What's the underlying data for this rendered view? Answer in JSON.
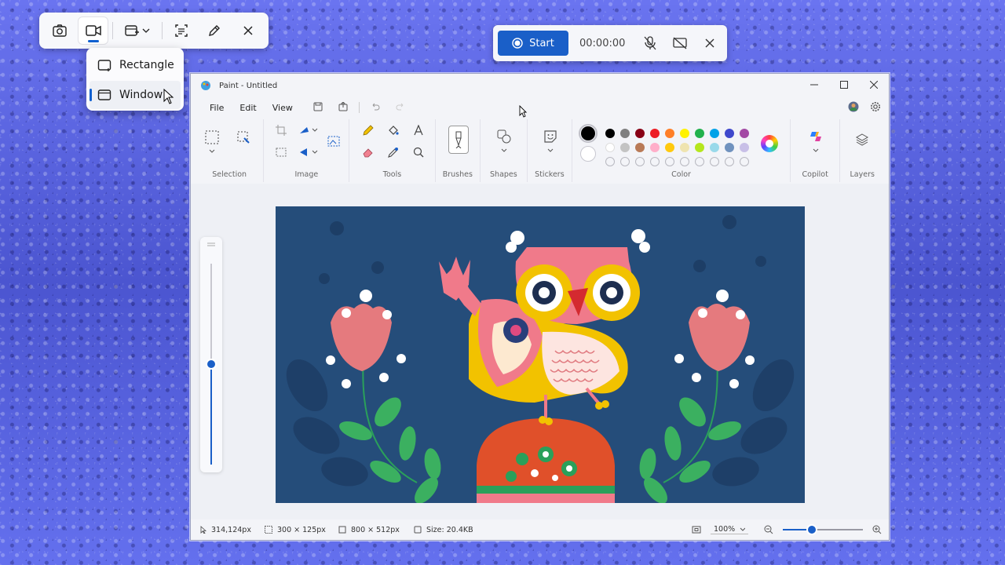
{
  "snip_toolbar": {
    "tools": [
      "camera-icon",
      "video-icon",
      "window-mode-icon",
      "text-actions-icon",
      "pen-icon",
      "close-icon"
    ]
  },
  "mode_menu": {
    "items": [
      {
        "label": "Rectangle",
        "icon": "rectangle-icon",
        "selected": false
      },
      {
        "label": "Window",
        "icon": "window-icon",
        "selected": true
      }
    ]
  },
  "record_bar": {
    "start_label": "Start",
    "timer": "00:00:00",
    "accent": "#1a5fc8"
  },
  "paint": {
    "title": "Paint - Untitled",
    "menu": [
      "File",
      "Edit",
      "View"
    ],
    "ribbon_groups": {
      "selection": "Selection",
      "image": "Image",
      "tools": "Tools",
      "brushes": "Brushes",
      "shapes": "Shapes",
      "stickers": "Stickers",
      "color": "Color",
      "copilot": "Copilot",
      "layers": "Layers"
    },
    "palette_row1": [
      "#000000",
      "#7f7f7f",
      "#880015",
      "#ed1c24",
      "#ff7f27",
      "#fff200",
      "#22b14c",
      "#00a2e8",
      "#3f48cc",
      "#a349a4"
    ],
    "palette_row2": [
      "#ffffff",
      "#c3c3c3",
      "#b97a57",
      "#ffaec9",
      "#ffc90e",
      "#efe4b0",
      "#b5e61d",
      "#99d9ea",
      "#7092be",
      "#c8bfe7"
    ],
    "primary_color": "#000000",
    "secondary_color": "#ffffff",
    "canvas_background": "#254d7a",
    "status": {
      "cursor": "314,124px",
      "selection": "300 × 125px",
      "canvas_size": "800 × 512px",
      "file_size": "Size: 20.4KB",
      "zoom": "100%"
    },
    "zoom_level": 0.5
  }
}
